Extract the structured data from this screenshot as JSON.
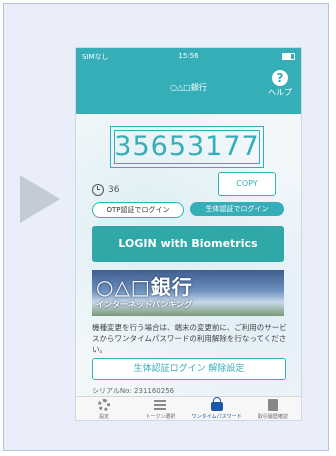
{
  "status_bar": {
    "carrier": "SIMなし",
    "time": "15:56"
  },
  "app": {
    "title": "○△□銀行",
    "help_label": "ヘルプ",
    "otp_code": "35653177",
    "timer": "36",
    "copy_label": "COPY",
    "otp_login_label": "OTP認証でログイン",
    "bio_login_label": "生体認証でログイン",
    "login_button": "LOGIN with Biometrics",
    "banner": {
      "logo": "○△□銀行",
      "subtitle": "インターネットバンキング"
    },
    "notice": "機種変更を行う場合は、端末の変更前に、ご利用のサービスからワンタイムパスワードの利用解除を行なってください。",
    "release_button": "生体認証ログイン 解除設定",
    "serial": "シリアルNo: 231160256"
  },
  "tabbar": [
    {
      "label": "設定",
      "icon": "gear-icon"
    },
    {
      "label": "トークン選択",
      "icon": "list-icon"
    },
    {
      "label": "ワンタイムパスワード",
      "icon": "lock-icon",
      "active": true
    },
    {
      "label": "取引履歴確認",
      "icon": "document-icon"
    }
  ],
  "colors": {
    "accent": "#35aeb8",
    "login_button": "#2fa8a7",
    "active_tab": "#1b58a8"
  }
}
